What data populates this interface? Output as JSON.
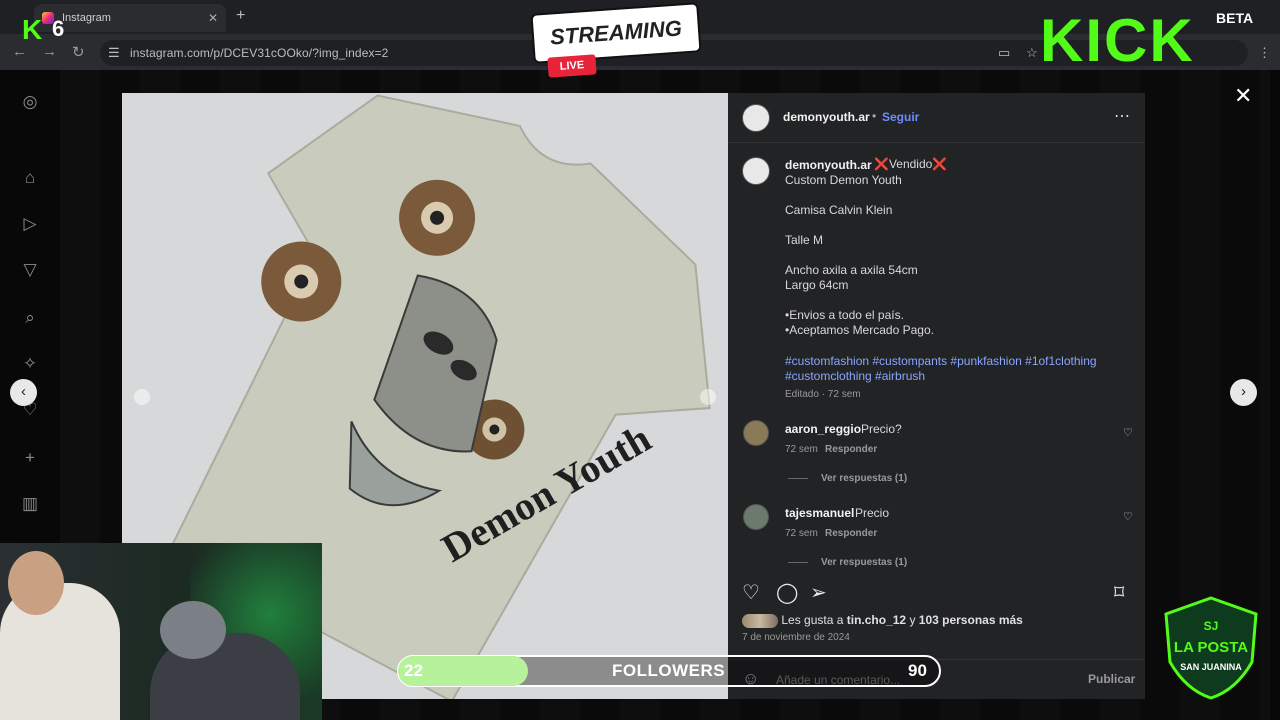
{
  "browser": {
    "tab_title": "Instagram",
    "url": "instagram.com/p/DCEV31cOOko/?img_index=2"
  },
  "overlay": {
    "kick_counter": "6",
    "streaming_label": "STREAMING",
    "live_label": "LIVE",
    "kick_brand": "KICK",
    "kick_beta": "BETA",
    "followers": {
      "current": "22",
      "label": "FOLLOWERS",
      "goal": "90",
      "progress_fraction": 0.24
    },
    "badge_top": "SJ",
    "badge_name": "LA POSTA",
    "badge_sub": "SAN JUANINA"
  },
  "post": {
    "author": "demonyouth.ar",
    "follow_label": "Seguir",
    "separator": "•",
    "caption_title": "❌Vendido❌",
    "caption_lines": [
      "Custom Demon Youth",
      "Camisa Calvin Klein",
      "Talle M",
      "Ancho axila a axila 54cm",
      "Largo 64cm",
      "•Envios a todo el país.",
      "•Aceptamos Mercado Pago."
    ],
    "hashtags": "#customfashion #custompants #punkfashion #1of1clothing #customclothing #airbrush",
    "edited_meta": "Editado · 72 sem",
    "shirt_text": "Demon Youth",
    "comments": [
      {
        "user": "aaron_reggio",
        "text": "Precio?",
        "time": "72 sem",
        "reply": "Responder",
        "view_replies": "Ver respuestas (1)"
      },
      {
        "user": "tajesmanuel",
        "text": "Precio",
        "time": "72 sem",
        "reply": "Responder",
        "view_replies": "Ver respuestas (1)"
      }
    ],
    "likes_prefix": "Les gusta a",
    "likes_user": "tin.cho_12",
    "likes_and": "y",
    "likes_rest": "103 personas más",
    "date": "7 de noviembre de 2024",
    "comment_placeholder": "Añade un comentario...",
    "publish_label": "Publicar"
  },
  "icons": {
    "more": "more-icon",
    "heart": "heart-icon",
    "comment": "comment-icon",
    "share": "share-icon",
    "bookmark": "bookmark-icon",
    "emoji": "emoji-icon",
    "close": "close-icon"
  }
}
